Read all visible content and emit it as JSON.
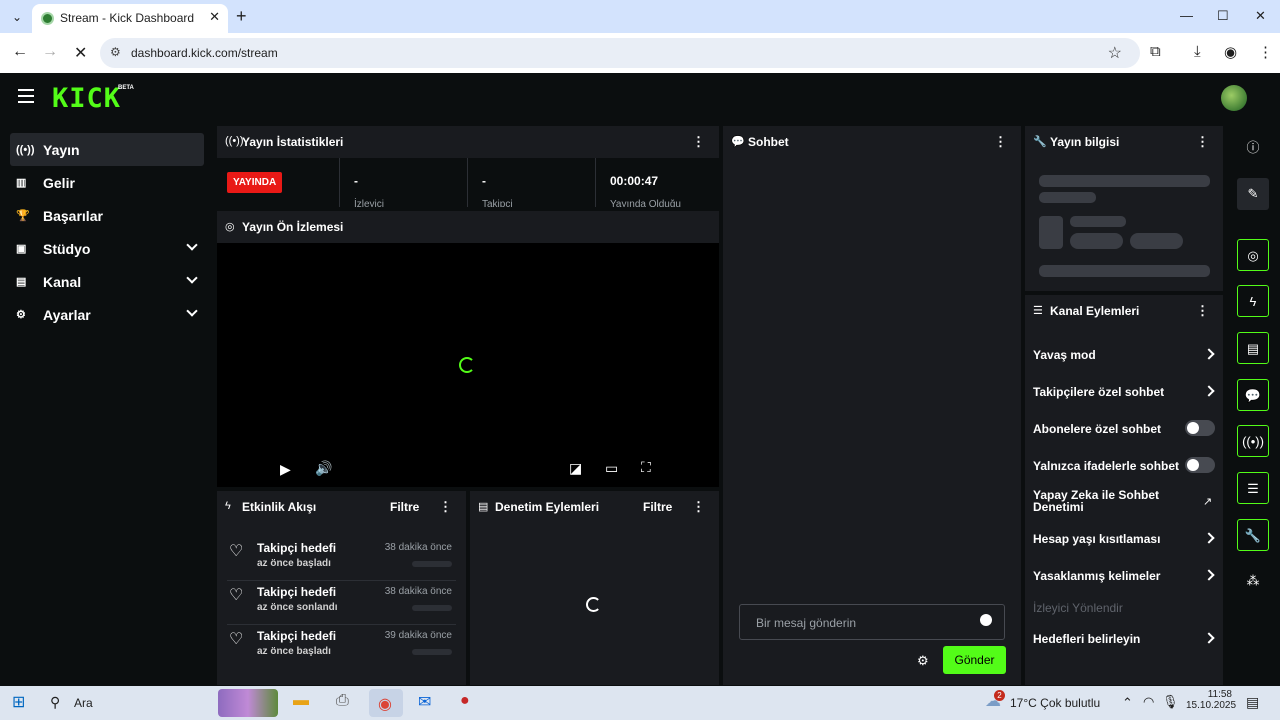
{
  "browser": {
    "tab_title": "Stream - Kick Dashboard",
    "url": "dashboard.kick.com/stream",
    "tab_close": "✕",
    "new_tab": "+",
    "minimize": "—",
    "maximize": "☐",
    "close": "✕"
  },
  "app": {
    "logo": "KICK",
    "logo_badge": "BETA"
  },
  "sidebar": {
    "items": [
      {
        "label": "Yayın",
        "icon": "broadcast-icon",
        "glyph": "((•))"
      },
      {
        "label": "Gelir",
        "icon": "chart-icon",
        "glyph": "▥"
      },
      {
        "label": "Başarılar",
        "icon": "trophy-icon",
        "glyph": "🏆"
      },
      {
        "label": "Stüdyo",
        "icon": "studio-icon",
        "glyph": "▣"
      },
      {
        "label": "Kanal",
        "icon": "channel-icon",
        "glyph": "▤"
      },
      {
        "label": "Ayarlar",
        "icon": "gear-icon",
        "glyph": "⚙"
      }
    ]
  },
  "stats": {
    "title": "Yayın İstatistikleri",
    "live_badge": "YAYINDA",
    "viewers_value": "-",
    "viewers_label": "İzleyici",
    "followers_value": "-",
    "followers_label": "Takipçi",
    "duration_value": "00:00:47",
    "duration_label": "Yayında Olduğu"
  },
  "preview": {
    "title": "Yayın Ön İzlemesi"
  },
  "activity": {
    "title": "Etkinlik Akışı",
    "filter": "Filtre",
    "items": [
      {
        "title": "Takipçi hedefi",
        "sub": "az önce başladı",
        "time": "38 dakika önce"
      },
      {
        "title": "Takipçi hedefi",
        "sub": "az önce sonlandı",
        "time": "38 dakika önce"
      },
      {
        "title": "Takipçi hedefi",
        "sub": "az önce başladı",
        "time": "39 dakika önce"
      }
    ]
  },
  "moderation": {
    "title": "Denetim Eylemleri",
    "filter": "Filtre"
  },
  "chat": {
    "title": "Sohbet",
    "placeholder": "Bir mesaj gönderin",
    "send": "Gönder"
  },
  "stream_info": {
    "title": "Yayın bilgisi"
  },
  "channel_actions": {
    "title": "Kanal Eylemleri",
    "items": [
      {
        "label": "Yavaş mod",
        "control": "chevron"
      },
      {
        "label": "Takipçilere özel sohbet",
        "control": "chevron"
      },
      {
        "label": "Abonelere özel sohbet",
        "control": "toggle"
      },
      {
        "label": "Yalnızca ifadelerle sohbet",
        "control": "toggle"
      },
      {
        "label": "Yapay Zeka ile Sohbet Denetimi",
        "control": "external"
      },
      {
        "label": "Hesap yaşı kısıtlaması",
        "control": "chevron"
      },
      {
        "label": "Yasaklanmış kelimeler",
        "control": "chevron"
      },
      {
        "label": "İzleyici Yönlendir",
        "control": "disabled"
      },
      {
        "label": "Hedefleri belirleyin",
        "control": "chevron"
      }
    ]
  },
  "taskbar": {
    "search": "Ara",
    "weather": "17°C  Çok bulutlu",
    "time": "11:58",
    "date": "15.10.2025",
    "notif_count": "2"
  }
}
